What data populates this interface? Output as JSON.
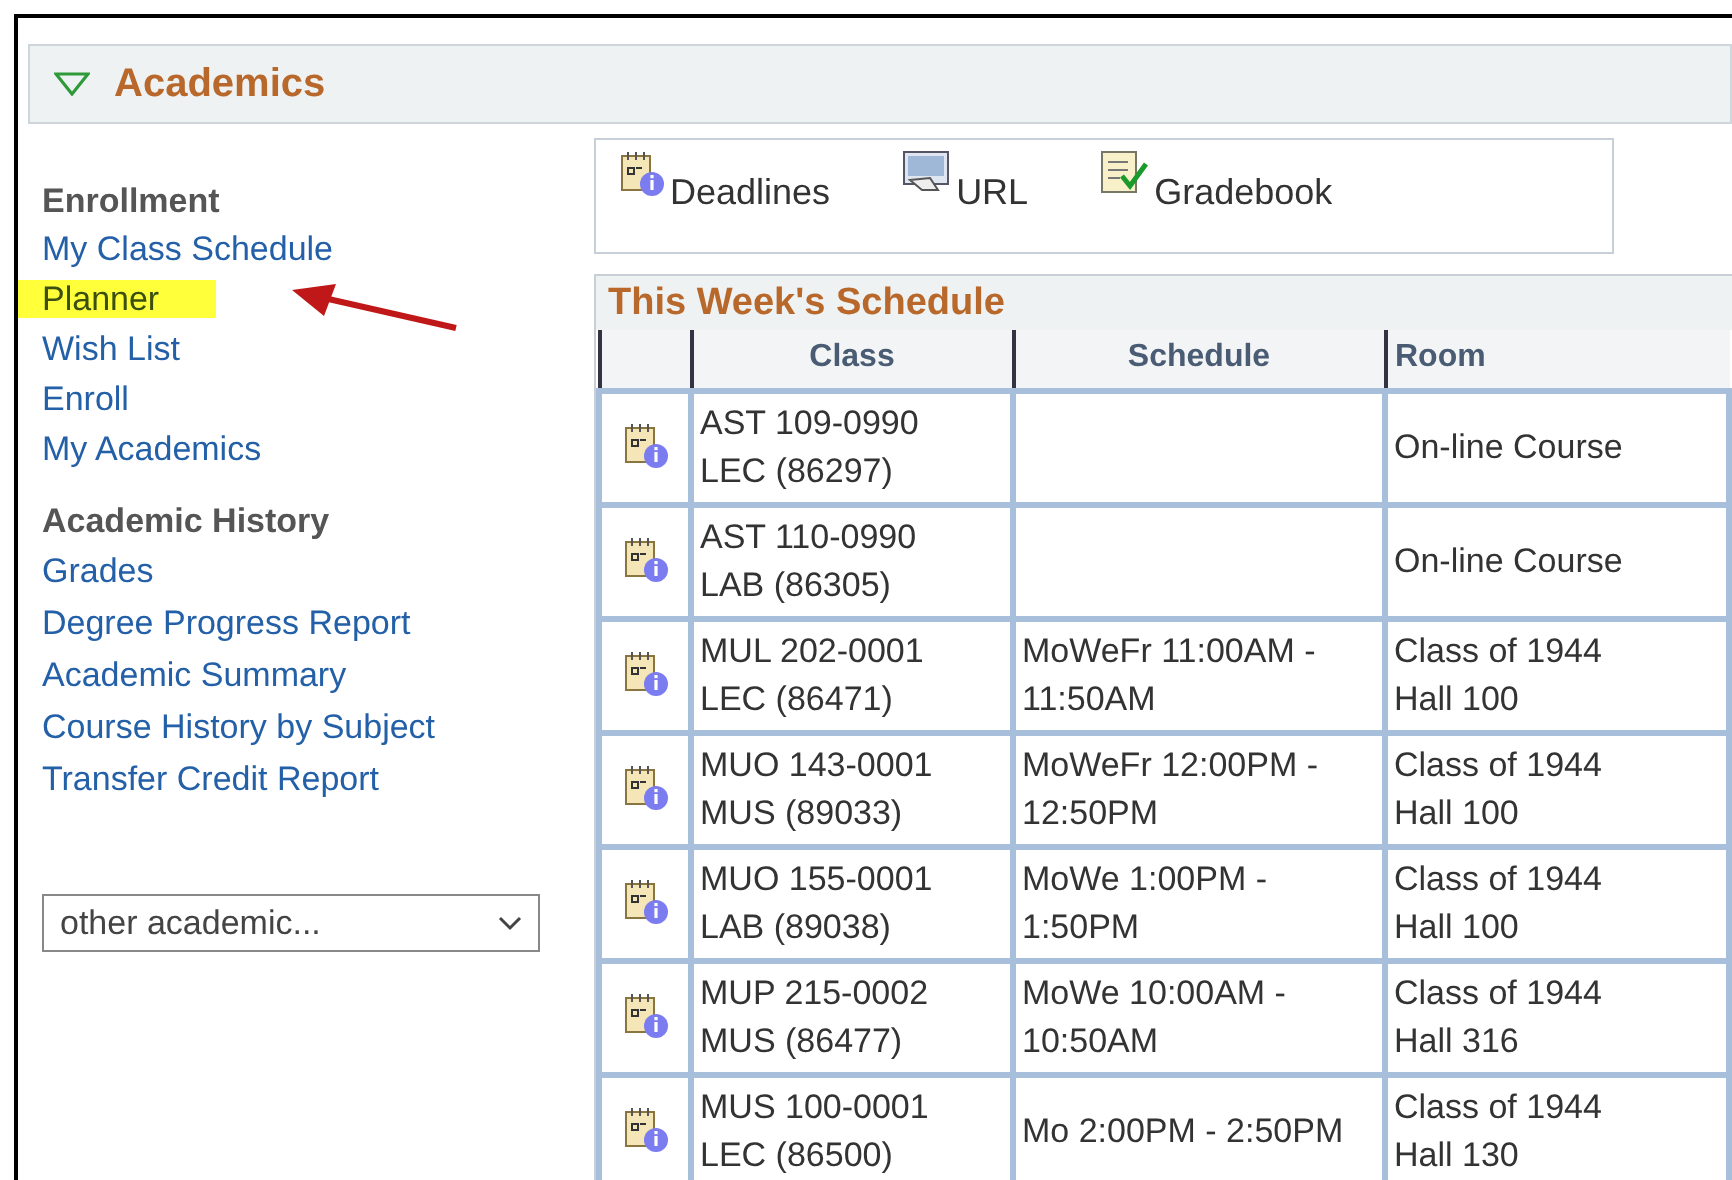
{
  "panel": {
    "title": "Academics",
    "expanded": true
  },
  "sidebar": {
    "sections": [
      {
        "heading": "Enrollment",
        "links": [
          {
            "label": "My Class Schedule",
            "highlighted": false
          },
          {
            "label": "Planner",
            "highlighted": true
          },
          {
            "label": "Wish List",
            "highlighted": false
          },
          {
            "label": "Enroll",
            "highlighted": false
          },
          {
            "label": "My Academics",
            "highlighted": false
          }
        ]
      },
      {
        "heading": "Academic History",
        "links": [
          {
            "label": "Grades",
            "highlighted": false
          },
          {
            "label": "Degree Progress Report",
            "highlighted": false
          },
          {
            "label": "Academic Summary",
            "highlighted": false
          },
          {
            "label": "Course History by Subject",
            "highlighted": false
          },
          {
            "label": "Transfer Credit Report",
            "highlighted": false
          }
        ]
      }
    ],
    "dropdown": {
      "value": "other academic..."
    }
  },
  "toolbar": [
    {
      "kind": "deadlines",
      "label": "Deadlines"
    },
    {
      "kind": "url",
      "label": "URL"
    },
    {
      "kind": "gradebook",
      "label": "Gradebook"
    }
  ],
  "schedule": {
    "title": "This Week's Schedule",
    "columns": [
      "Class",
      "Schedule",
      "Room"
    ],
    "rows": [
      {
        "class": "AST 109-0990\nLEC (86297)",
        "schedule": "",
        "room": "On-line Course"
      },
      {
        "class": "AST 110-0990\nLAB (86305)",
        "schedule": "",
        "room": "On-line Course"
      },
      {
        "class": "MUL 202-0001\nLEC (86471)",
        "schedule": "MoWeFr 11:00AM -\n11:50AM",
        "room": "Class of 1944\nHall 100"
      },
      {
        "class": "MUO 143-0001\nMUS (89033)",
        "schedule": "MoWeFr 12:00PM -\n12:50PM",
        "room": "Class of 1944\nHall 100"
      },
      {
        "class": "MUO 155-0001\nLAB (89038)",
        "schedule": "MoWe 1:00PM -\n1:50PM",
        "room": "Class of 1944\nHall 100"
      },
      {
        "class": "MUP 215-0002\nMUS (86477)",
        "schedule": "MoWe 10:00AM -\n10:50AM",
        "room": "Class of 1944\nHall 316"
      },
      {
        "class": "MUS 100-0001\nLEC (86500)",
        "schedule": "Mo 2:00PM - 2:50PM",
        "room": "Class of 1944\nHall 130"
      }
    ]
  }
}
